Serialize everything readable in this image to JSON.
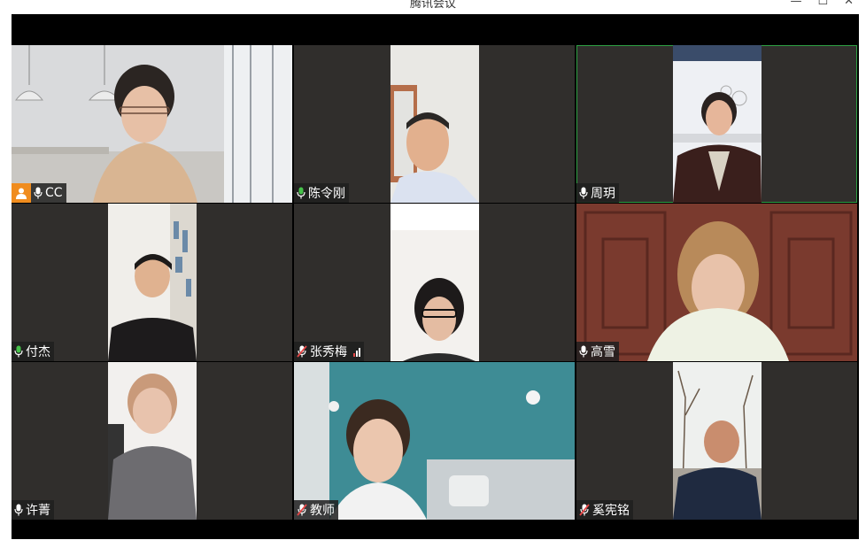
{
  "window": {
    "title": "腾讯会议",
    "minimize": "—",
    "maximize": "☐",
    "close": "✕"
  },
  "colors": {
    "accent_active": "#2ea043",
    "host_badge": "#f08c1e",
    "muted_mic": "#e64646",
    "tile_bg": "#302e2c"
  },
  "participants": [
    {
      "name": "CC",
      "mic": "on",
      "host": true,
      "active": false
    },
    {
      "name": "陈令刚",
      "mic": "on",
      "host": false,
      "active": false
    },
    {
      "name": "周玥",
      "mic": "on",
      "host": false,
      "active": true
    },
    {
      "name": "付杰",
      "mic": "on",
      "host": false,
      "active": false
    },
    {
      "name": "张秀梅",
      "mic": "muted",
      "host": false,
      "active": false,
      "signal": true
    },
    {
      "name": "高雪",
      "mic": "on",
      "host": false,
      "active": false
    },
    {
      "name": "许菁",
      "mic": "on",
      "host": false,
      "active": false
    },
    {
      "name": "教师",
      "mic": "muted",
      "host": false,
      "active": false
    },
    {
      "name": "奚宪铭",
      "mic": "muted",
      "host": false,
      "active": false
    }
  ]
}
